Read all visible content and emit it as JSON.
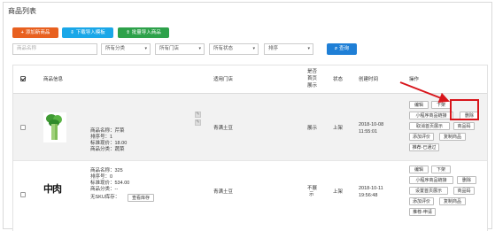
{
  "page": {
    "title": "商品列表",
    "toolbar": {
      "add_label": "添加新商品",
      "download_label": "下载导入模板",
      "import_label": "批量导入商品"
    },
    "filters": {
      "name_placeholder": "商品名称",
      "category": "所有分类",
      "store": "所有门店",
      "status": "所有状态",
      "sort": "排序",
      "search_label": "查询"
    }
  },
  "table": {
    "headers": {
      "info": "商品信息",
      "store": "适用门店",
      "homepage_l1": "是否",
      "homepage_l2": "首页",
      "homepage_l3": "展示",
      "status": "状态",
      "created": "创建时间",
      "ops": "操作"
    },
    "rows": [
      {
        "name": "商品名称：芹菜",
        "sort": "排序号：1",
        "price": "标准现价：18.00",
        "category": "商品分类：蔬菜",
        "store": "青满土豆",
        "homepage": "展示",
        "status": "上架",
        "created_date": "2018-10-08",
        "created_time": "11:55:01",
        "ops": {
          "edit": "编辑",
          "shelf": "下架",
          "mini_link": "小程序商品链接",
          "delete": "删除",
          "cancel_home": "取消首页展示",
          "product_code": "商品码",
          "add_review": "添加评价",
          "copy": "复制商品",
          "recommend": "推荐-已通过"
        }
      },
      {
        "name": "商品名称：325",
        "sort": "排序号：0",
        "price": "标准现价：534.00",
        "category": "商品分类：--",
        "no_sku": "无SKU库存：",
        "view_stock": "查看库存",
        "thumb_text": "中肉",
        "store": "青满土豆",
        "homepage_l1": "不展",
        "homepage_l2": "示",
        "status": "上架",
        "created_date": "2018-10-11",
        "created_time": "19:56:48",
        "ops": {
          "edit": "编辑",
          "shelf": "下架",
          "mini_link": "小程序商品链接",
          "delete": "删除",
          "set_home": "设置首页展示",
          "product_code": "商品码",
          "add_review": "添加评价",
          "copy": "复制商品",
          "recommend": "推荐-申请"
        }
      }
    ]
  },
  "colors": {
    "add_button": "#e8601f",
    "download_button": "#1aa7e8",
    "import_button": "#2da14a",
    "search_button": "#1f7fd6",
    "highlight": "#d8151b"
  },
  "icons": {
    "add": "plus-icon",
    "download": "download-icon",
    "import": "upload-icon",
    "search": "search-icon",
    "edit": "pencil-icon"
  }
}
